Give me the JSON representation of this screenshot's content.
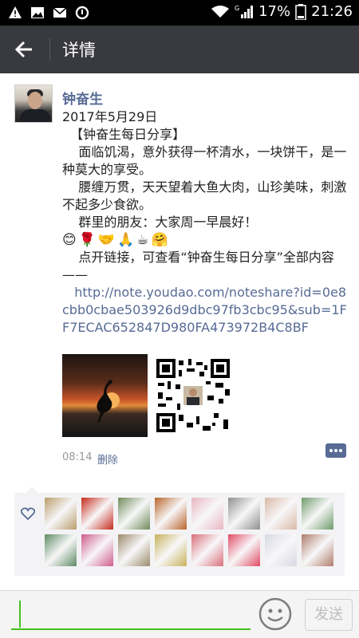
{
  "status_bar": {
    "network": "G",
    "battery_percent": "17%",
    "time": "21:26",
    "icons": [
      "warning-icon",
      "image-icon",
      "mail-icon",
      "sync-icon",
      "wifi-icon",
      "signal-icon",
      "battery-icon"
    ]
  },
  "header": {
    "title": "详情",
    "back_icon": "arrow-left-icon"
  },
  "post": {
    "author": "钟奋生",
    "lines": [
      "2017年5月29日",
      "  【钟奋生每日分享】",
      "    面临饥渴，意外获得一杯清水，一块饼干，是一种莫大的享受。",
      "    腰缠万贯，天天望着大鱼大肉，山珍美味，刺激不起多少食欲。",
      "    群里的朋友：大家周一早晨好！"
    ],
    "emojis": "😊🌹🤝🙏☕🤗",
    "link_intro": "    点开链接，可查看“钟奋生每日分享”全部内容——",
    "link": "   http://note.youdao.com/noteshare?id=0e8cbb0cbae503926d9dbc97fb3cbc95&sub=1FF7ECAC652847D980FA473972B4C8BF",
    "time": "08:14",
    "delete_label": "删除"
  },
  "likes": {
    "icon": "heart-icon",
    "thumb_colors": [
      "#b99d6b",
      "#c62a1c",
      "#6f8a5a",
      "#b8642a",
      "#e9b6c3",
      "#8f8f8f",
      "#d9b8a7",
      "#6f9a6a",
      "#5e8a63",
      "#cf5a8c",
      "#9b8a6b",
      "#c7b25a",
      "#d96f7a",
      "#e14a64",
      "#d8d8e4",
      "#b07b6b"
    ]
  },
  "input_bar": {
    "emoji_icon": "smiley-icon",
    "send_label": "发送"
  }
}
